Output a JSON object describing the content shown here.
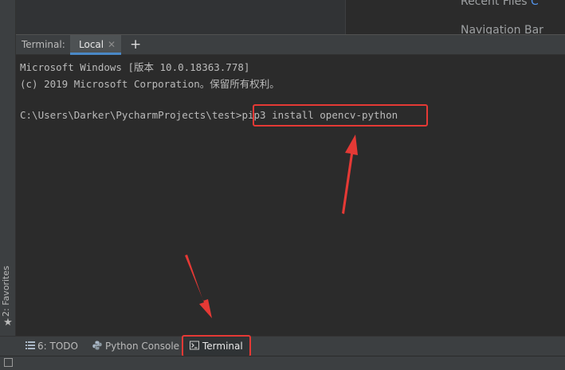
{
  "editor": {
    "hint_recent_files": "Recent Files",
    "hint_recent_files_key": "C",
    "hint_navigation_bar": "Navigation Bar"
  },
  "terminal": {
    "title": "Terminal:",
    "tab_label": "Local",
    "lines": [
      "Microsoft Windows [版本 10.0.18363.778]",
      "(c) 2019 Microsoft Corporation。保留所有权利。",
      "",
      "C:\\Users\\Darker\\PycharmProjects\\test>"
    ],
    "prompt": "C:\\Users\\Darker\\PycharmProjects\\test>",
    "command": "pip3 install opencv-python"
  },
  "left_strip": {
    "favorites_label": "2: Favorites"
  },
  "bottom_bar": {
    "todo_label": "6: TODO",
    "python_console_label": "Python Console",
    "terminal_label": "Terminal"
  },
  "colors": {
    "annotation_red": "#e53935",
    "tab_accent": "#4a88c7"
  }
}
